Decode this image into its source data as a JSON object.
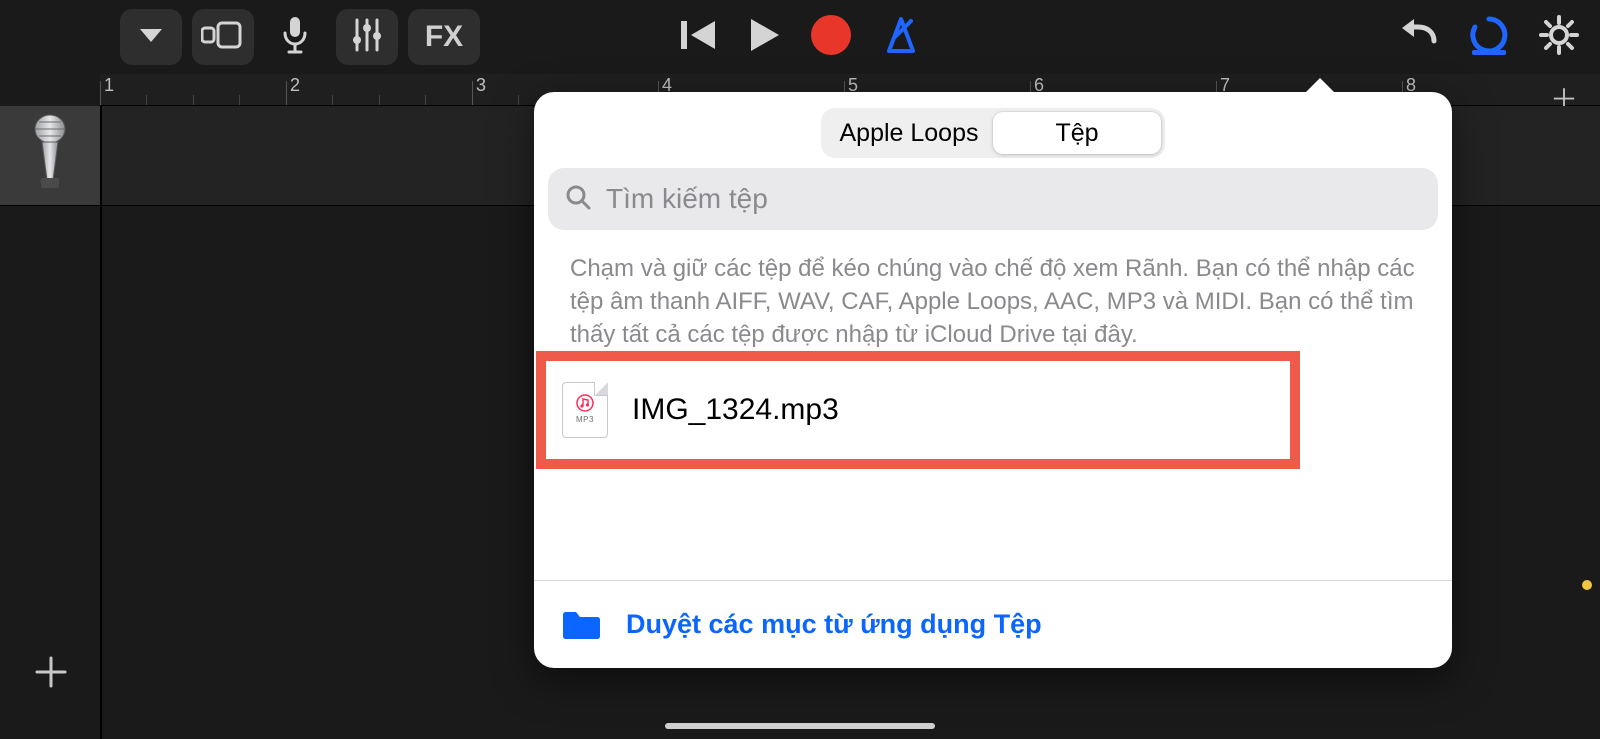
{
  "toolbar": {
    "left_icons": [
      "chevron-down",
      "view-mode",
      "microphone",
      "mixer",
      "fx"
    ],
    "fx_label": "FX",
    "center_icons": [
      "skip-back",
      "play",
      "record",
      "metronome"
    ],
    "right_icons": [
      "undo",
      "loop-browser",
      "settings"
    ]
  },
  "ruler": {
    "marks": [
      "1",
      "2",
      "3",
      "4",
      "5",
      "6",
      "7",
      "8"
    ]
  },
  "popover": {
    "tabs": [
      "Apple Loops",
      "Tệp"
    ],
    "active_tab_index": 1,
    "search_placeholder": "Tìm kiếm tệp",
    "hint_text": "Chạm và giữ các tệp để kéo chúng vào chế độ xem Rãnh. Bạn có thể nhập các tệp âm thanh AIFF, WAV, CAF, Apple Loops, AAC, MP3 và MIDI. Bạn có thể tìm thấy tất cả các tệp được nhập từ iCloud Drive tại đây.",
    "file": {
      "name": "IMG_1324.mp3",
      "ext_label": "MP3"
    },
    "browse_label": "Duyệt các mục từ ứng dụng Tệp"
  },
  "colors": {
    "record": "#e8362a",
    "accent_blue": "#1e66ff",
    "loop_blue": "#1e66ff",
    "highlight": "#ef5a4a"
  }
}
